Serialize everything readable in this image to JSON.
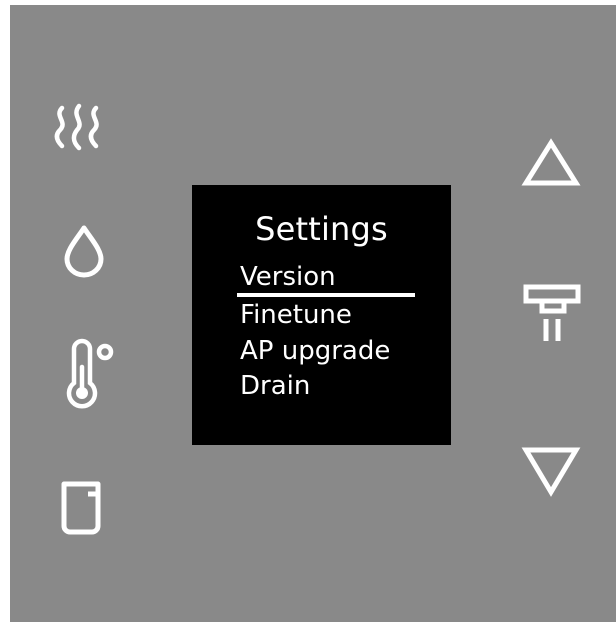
{
  "screen": {
    "title": "Settings",
    "menu_items": [
      {
        "label": "Version",
        "selected": true
      },
      {
        "label": "Finetune",
        "selected": false
      },
      {
        "label": "AP upgrade",
        "selected": false
      },
      {
        "label": "Drain",
        "selected": false
      }
    ]
  },
  "left_buttons": [
    {
      "icon": "steam-icon"
    },
    {
      "icon": "water-drop-icon"
    },
    {
      "icon": "thermometer-icon"
    },
    {
      "icon": "cup-icon"
    }
  ],
  "right_buttons": [
    {
      "icon": "arrow-up-icon"
    },
    {
      "icon": "dispense-icon"
    },
    {
      "icon": "arrow-down-icon"
    }
  ],
  "colors": {
    "panel": "#898989",
    "screen": "#000000",
    "icon": "#ffffff",
    "text": "#ffffff"
  }
}
